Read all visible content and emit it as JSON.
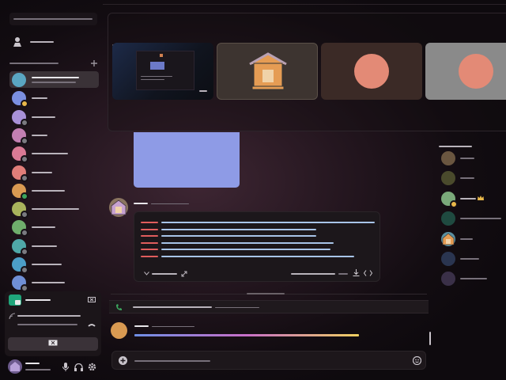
{
  "window": {
    "title": "",
    "accent": "#5865f2"
  },
  "sidebar": {
    "server_header": "",
    "friends_label": "",
    "dm_section_label": "",
    "add_dm_icon": "plus-icon",
    "dms": [
      {
        "name": "",
        "status": "",
        "color": "#5aa6c2",
        "status_color": "",
        "selected": true
      },
      {
        "name": "",
        "status": "",
        "color": "#7b8fe0",
        "status_color": "#e8b84a",
        "selected": false
      },
      {
        "name": "",
        "status": "",
        "color": "#a991d8",
        "status_color": "#7a7a80",
        "selected": false
      },
      {
        "name": "",
        "status": "",
        "color": "#c27fb2",
        "status_color": "#7a7a80",
        "selected": false
      },
      {
        "name": "",
        "status": "",
        "color": "#d97a95",
        "status_color": "#7a7a80",
        "selected": false
      },
      {
        "name": "",
        "status": "",
        "color": "#e07e79",
        "status_color": "#7a7a80",
        "selected": false
      },
      {
        "name": "",
        "status": "",
        "color": "#d99a52",
        "status_color": "#3ba55d",
        "selected": false
      },
      {
        "name": "",
        "status": "",
        "color": "#a9b35c",
        "status_color": "#7a7a80",
        "selected": false
      },
      {
        "name": "",
        "status": "",
        "color": "#6fae6c",
        "status_color": "#7a7a80",
        "selected": false
      },
      {
        "name": "",
        "status": "",
        "color": "#4fa8a8",
        "status_color": "#7a7a80",
        "selected": false
      },
      {
        "name": "",
        "status": "",
        "color": "#4c9ec7",
        "status_color": "#7a7a80",
        "selected": false
      },
      {
        "name": "",
        "status": "",
        "color": "#6f8fd6",
        "status_color": "#7a7a80",
        "selected": false
      }
    ]
  },
  "voice_panel": {
    "activity_title": "",
    "connection_status": "",
    "channel_info": "",
    "stream_button_icon": "screen-share-off-icon"
  },
  "user_panel": {
    "username": "",
    "tag": "",
    "icons": [
      "microphone-icon",
      "headphones-icon",
      "gear-icon"
    ]
  },
  "stream": {
    "tiles": [
      {
        "type": "screen",
        "live": true
      },
      {
        "type": "avatar",
        "color": "#8a7560"
      },
      {
        "type": "user",
        "color": "#e38a76",
        "bg": "#3b2a26"
      },
      {
        "type": "user",
        "color": "#e38a76",
        "bg": "#8a8a8a"
      }
    ]
  },
  "chat": {
    "image_attachment_color": "#8e9be6",
    "message_author": "",
    "message_timestamp": "",
    "code_block": {
      "filename": "",
      "lines": 6
    },
    "call_banner": {
      "text": "",
      "duration": ""
    },
    "typing_user": "",
    "composer_placeholder": "",
    "colors": {
      "line_red": "#e05d5d",
      "line_blue": "#a8c4e8",
      "progress_start": "#6f8fe6",
      "progress_end": "#f0d060"
    }
  },
  "members": {
    "section_label": "",
    "items": [
      {
        "name": "",
        "color": "#6a5640",
        "status_color": ""
      },
      {
        "name": "",
        "color": "#4a4a2c",
        "status_color": ""
      },
      {
        "name": "",
        "color": "#7aa97a",
        "status_color": "#e8b84a",
        "crown": true
      },
      {
        "name": "",
        "color": "#1f4a40",
        "status_color": ""
      },
      {
        "name": "",
        "color": "#5a8fa0",
        "status_color": "",
        "avatar_icon": "house-icon"
      },
      {
        "name": "",
        "color": "#2a3550",
        "status_color": ""
      },
      {
        "name": "",
        "color": "#3a3048",
        "status_color": ""
      }
    ]
  }
}
